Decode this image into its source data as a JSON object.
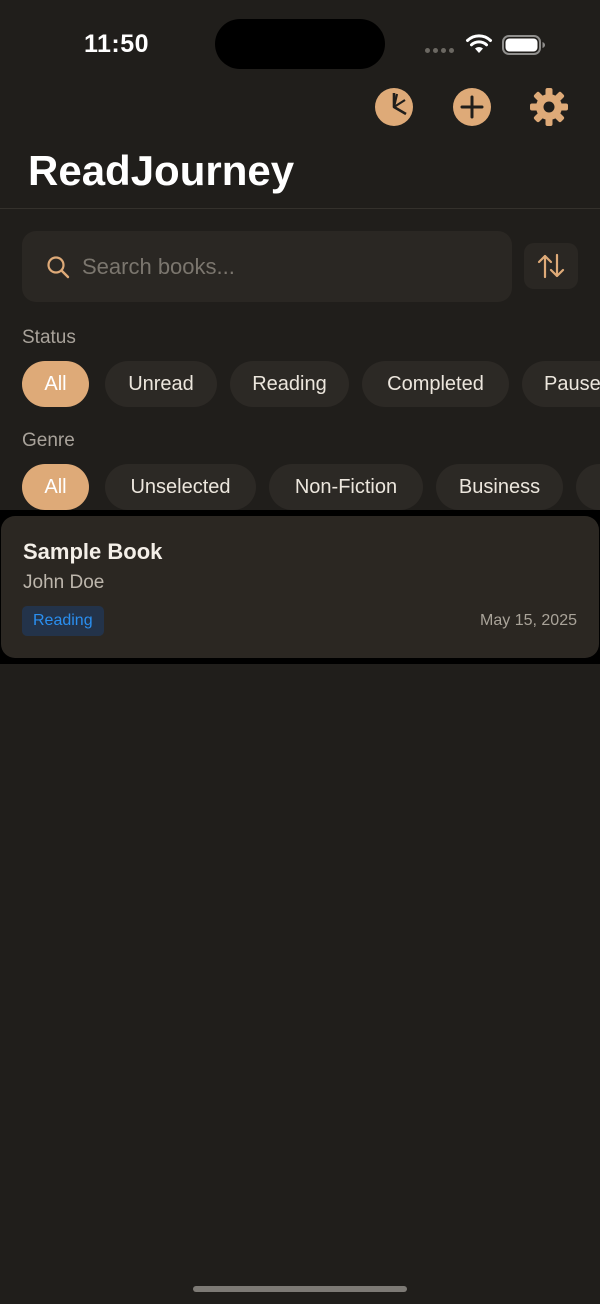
{
  "status_bar": {
    "time": "11:50"
  },
  "toolbar": {
    "stats_icon": "pie-chart-icon",
    "add_icon": "plus-circle-icon",
    "settings_icon": "gear-icon"
  },
  "header": {
    "title": "ReadJourney"
  },
  "search": {
    "placeholder": "Search books...",
    "value": "",
    "sort_icon": "sort-arrows-icon"
  },
  "filters": {
    "status": {
      "label": "Status",
      "chips": [
        "All",
        "Unread",
        "Reading",
        "Completed",
        "Paused"
      ],
      "selected": "All"
    },
    "genre": {
      "label": "Genre",
      "chips": [
        "All",
        "Unselected",
        "Non-Fiction",
        "Business"
      ],
      "selected": "All"
    }
  },
  "books": [
    {
      "title": "Sample Book",
      "author": "John Doe",
      "status": "Reading",
      "date": "May 15, 2025"
    }
  ],
  "colors": {
    "accent": "#deaa78",
    "background": "#201e1b",
    "card": "#2b2722",
    "status_reading": "#2a8ff0"
  }
}
